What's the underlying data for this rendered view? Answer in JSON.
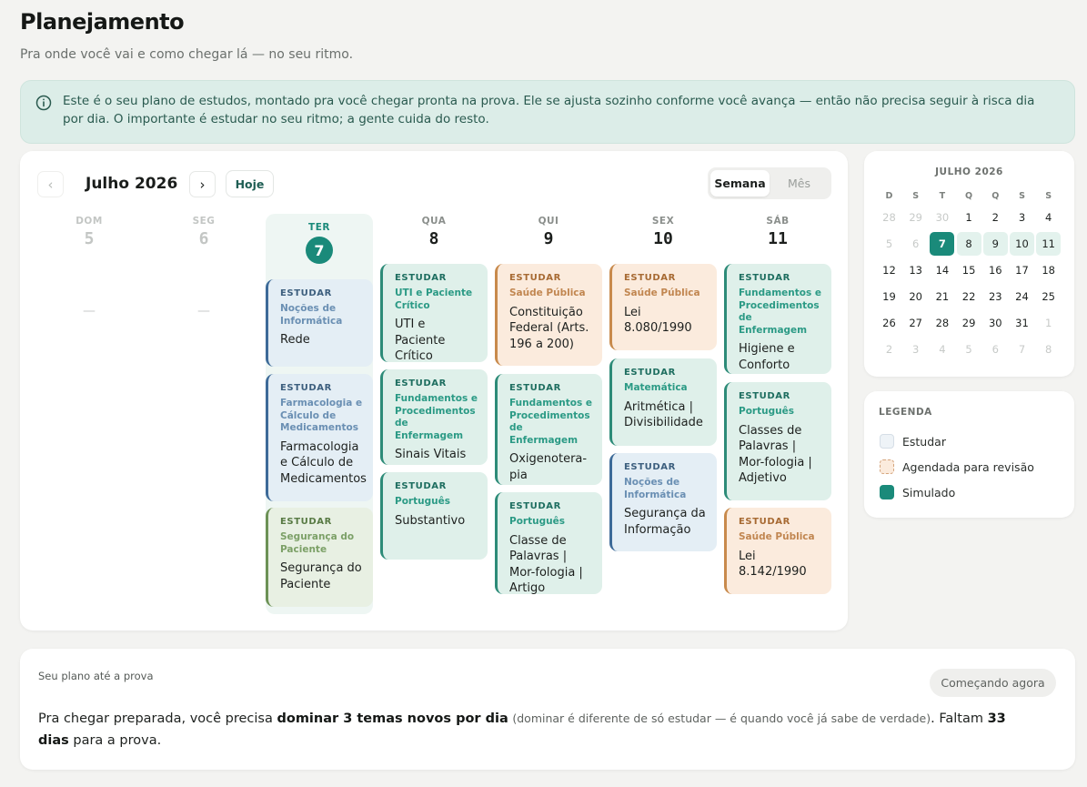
{
  "header": {
    "title": "Planejamento",
    "subtitle": "Pra onde você vai e como chegar lá — no seu ritmo."
  },
  "info_banner": {
    "icon": "info-icon",
    "text": "Este é o seu plano de estudos, montado pra você chegar pronta na prova. Ele se ajusta sozinho conforme você avança — então não precisa seguir à risca dia por dia. O importante é estudar no seu ritmo; a gente cuida do resto."
  },
  "calendar": {
    "month_label": "Julho 2026",
    "prev_icon": "chevron-left-icon",
    "next_icon": "chevron-right-icon",
    "today_label": "Hoje",
    "view_week": "Semana",
    "view_month": "Mês",
    "active_view": "Semana",
    "empty_marker": "—",
    "days": [
      {
        "name": "DOM",
        "num": "5",
        "state": "past"
      },
      {
        "name": "SEG",
        "num": "6",
        "state": "past"
      },
      {
        "name": "TER",
        "num": "7",
        "state": "today"
      },
      {
        "name": "QUA",
        "num": "8",
        "state": "future"
      },
      {
        "name": "QUI",
        "num": "9",
        "state": "future"
      },
      {
        "name": "SEX",
        "num": "10",
        "state": "future"
      },
      {
        "name": "SÁB",
        "num": "11",
        "state": "future"
      }
    ],
    "tasks": {
      "ter": [
        {
          "kind": "ESTUDAR",
          "subject": "Noções de Informática",
          "topic": "Rede",
          "color": "blue"
        },
        {
          "kind": "ESTUDAR",
          "subject": "Farmacologia e Cálculo de Medicamentos",
          "topic": "Farmacologia e Cálculo de Medicamentos",
          "color": "blue"
        },
        {
          "kind": "ESTUDAR",
          "subject": "Segurança do Paciente",
          "topic": "Segurança do Paciente",
          "color": "green"
        }
      ],
      "qua": [
        {
          "kind": "ESTUDAR",
          "subject": "UTI e Paciente Crítico",
          "topic": "UTI e Paciente Crítico",
          "color": "teal"
        },
        {
          "kind": "ESTUDAR",
          "subject": "Fundamentos e Procedimentos de Enfermagem",
          "topic": "Sinais Vitais",
          "color": "teal"
        },
        {
          "kind": "ESTUDAR",
          "subject": "Português",
          "topic": "Substantivo",
          "color": "teal"
        }
      ],
      "qui": [
        {
          "kind": "ESTUDAR",
          "subject": "Saúde Pública",
          "topic": "Constituição Federal (Arts. 196 a 200)",
          "color": "orange"
        },
        {
          "kind": "ESTUDAR",
          "subject": "Fundamentos e Procedimentos de Enfermagem",
          "topic": "Oxigenotera-pia",
          "color": "teal"
        },
        {
          "kind": "ESTUDAR",
          "subject": "Português",
          "topic": "Classe de Palavras | Mor-fologia | Artigo",
          "color": "teal"
        }
      ],
      "sex": [
        {
          "kind": "ESTUDAR",
          "subject": "Saúde Pública",
          "topic": "Lei 8.080/1990",
          "color": "orange"
        },
        {
          "kind": "ESTUDAR",
          "subject": "Matemática",
          "topic": "Aritmética | Divisibilidade",
          "color": "teal"
        },
        {
          "kind": "ESTUDAR",
          "subject": "Noções de Informática",
          "topic": "Segurança da Informação",
          "color": "blue"
        }
      ],
      "sab": [
        {
          "kind": "ESTUDAR",
          "subject": "Fundamentos e Procedimentos de Enfermagem",
          "topic": "Higiene e Conforto",
          "color": "teal"
        },
        {
          "kind": "ESTUDAR",
          "subject": "Português",
          "topic": "Classes de Palavras | Mor-fologia | Adjetivo",
          "color": "teal"
        },
        {
          "kind": "ESTUDAR",
          "subject": "Saúde Pública",
          "topic": "Lei 8.142/1990",
          "color": "orange"
        }
      ]
    }
  },
  "mini_calendar": {
    "title": "JULHO 2026",
    "weekdays": [
      "D",
      "S",
      "T",
      "Q",
      "Q",
      "S",
      "S"
    ],
    "weeks": [
      [
        "28",
        "29",
        "30",
        "1",
        "2",
        "3",
        "4"
      ],
      [
        "5",
        "6",
        "7",
        "8",
        "9",
        "10",
        "11"
      ],
      [
        "12",
        "13",
        "14",
        "15",
        "16",
        "17",
        "18"
      ],
      [
        "19",
        "20",
        "21",
        "22",
        "23",
        "24",
        "25"
      ],
      [
        "26",
        "27",
        "28",
        "29",
        "30",
        "31",
        "1"
      ],
      [
        "2",
        "3",
        "4",
        "5",
        "6",
        "7",
        "8"
      ]
    ],
    "selected_day": "7"
  },
  "legend": {
    "title": "LEGENDA",
    "items": [
      {
        "label": "Estudar",
        "swatch": "study"
      },
      {
        "label": "Agendada para revisão",
        "swatch": "review"
      },
      {
        "label": "Simulado",
        "swatch": "simulado"
      }
    ]
  },
  "plan": {
    "label": "Seu plano até a prova",
    "badge": "Começando agora",
    "text_prefix": "Pra chegar preparada, você precisa ",
    "text_bold": "dominar 3 temas novos por dia",
    "text_note": "(dominar é diferente de só estudar — é quando você já sabe de verdade)",
    "text_middle": ". Faltam ",
    "days_left": "33 dias",
    "text_suffix": " para a prova."
  },
  "colors": {
    "accent": "#1a8a7a",
    "background": "#f3f3f1",
    "banner": "#dcede8"
  }
}
